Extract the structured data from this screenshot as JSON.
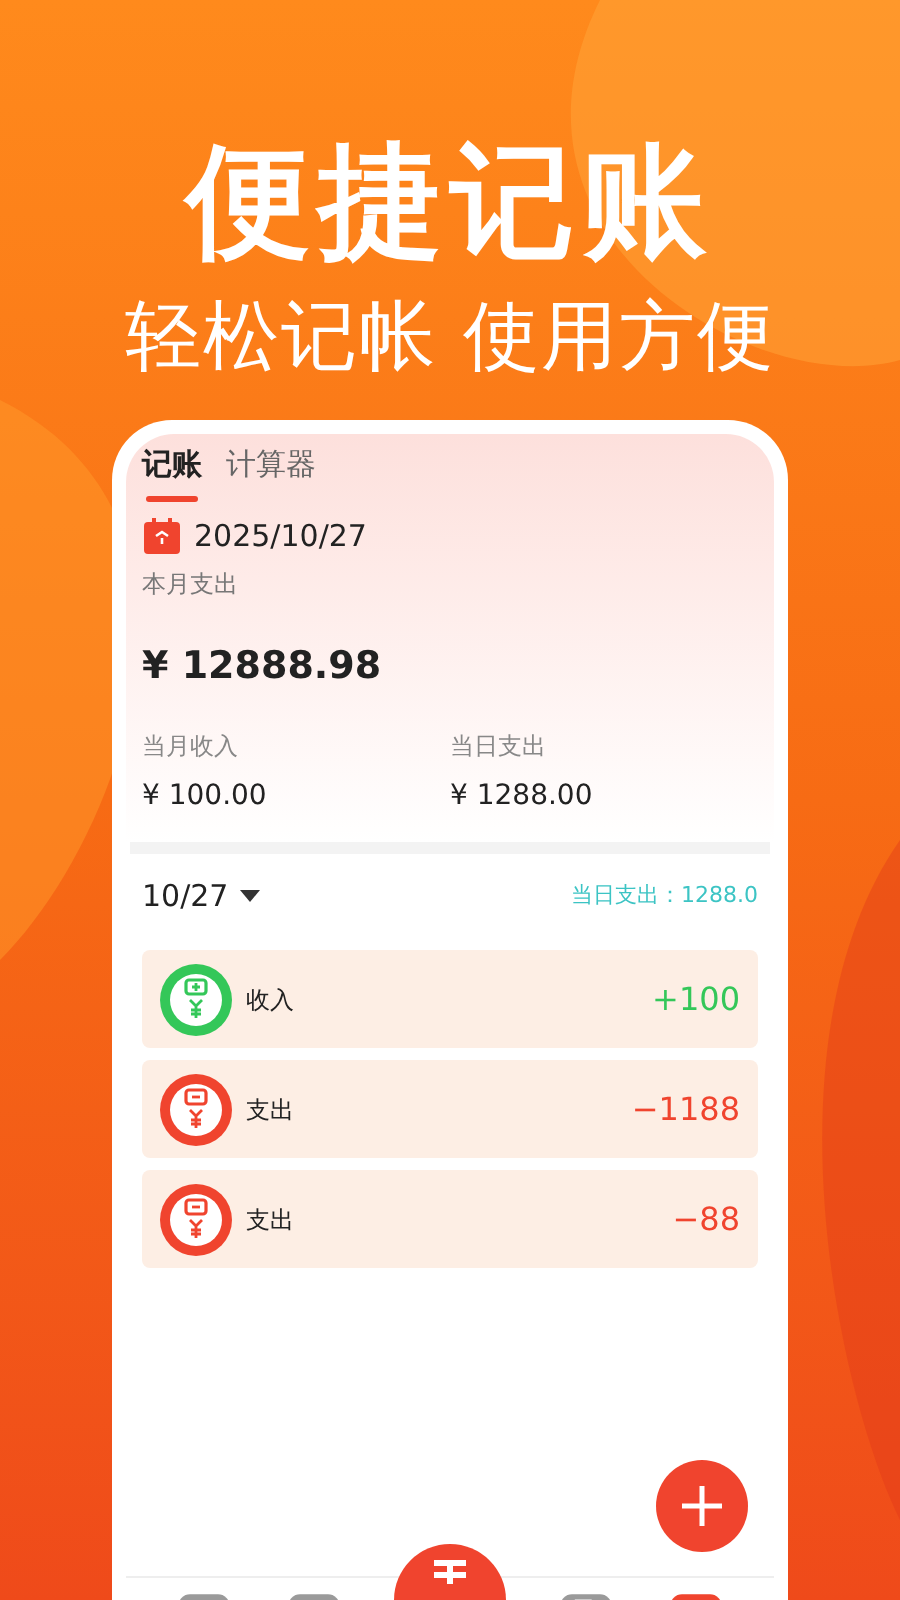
{
  "promo": {
    "headline": "便捷记账",
    "subtitle": "轻松记帐 使用方便"
  },
  "tabs": [
    {
      "label": "记账",
      "selected": true
    },
    {
      "label": "计算器",
      "selected": false
    }
  ],
  "date": "2025/10/27",
  "summary": {
    "month_expense_label": "本月支出",
    "month_expense": "¥ 12888.98",
    "stats": [
      {
        "label": "当月收入",
        "value": "¥ 100.00"
      },
      {
        "label": "当日支出",
        "value": "¥ 1288.00"
      }
    ]
  },
  "day": {
    "date": "10/27",
    "total": "当日支出：1288.0"
  },
  "records": [
    {
      "kind": "income",
      "label": "收入",
      "amount": "+100"
    },
    {
      "kind": "expense",
      "label": "支出",
      "amount": "−1188"
    },
    {
      "kind": "expense",
      "label": "支出",
      "amount": "−88"
    }
  ],
  "nav": [
    {
      "kind": "home",
      "selected": false
    },
    {
      "kind": "ledger",
      "selected": false
    },
    {
      "kind": "center",
      "selected": false
    },
    {
      "kind": "doc",
      "selected": false
    },
    {
      "kind": "bill",
      "selected": true
    }
  ]
}
